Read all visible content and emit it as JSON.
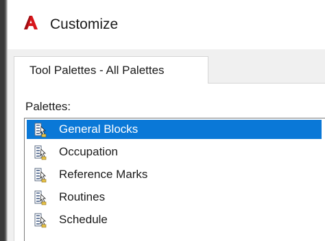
{
  "window": {
    "title": "Customize",
    "logo_icon": "autocad-logo-icon",
    "accent_color": "#0a78d7",
    "logo_color": "#d7161b"
  },
  "tabs": [
    {
      "label": "Tool Palettes - All Palettes",
      "active": true
    }
  ],
  "palettes": {
    "label": "Palettes:",
    "selected_index": 0,
    "items": [
      {
        "label": "General Blocks",
        "icon": "tool-palette-icon"
      },
      {
        "label": "Occupation",
        "icon": "tool-palette-icon"
      },
      {
        "label": "Reference Marks",
        "icon": "tool-palette-icon"
      },
      {
        "label": "Routines",
        "icon": "tool-palette-icon"
      },
      {
        "label": "Schedule",
        "icon": "tool-palette-icon"
      }
    ]
  }
}
